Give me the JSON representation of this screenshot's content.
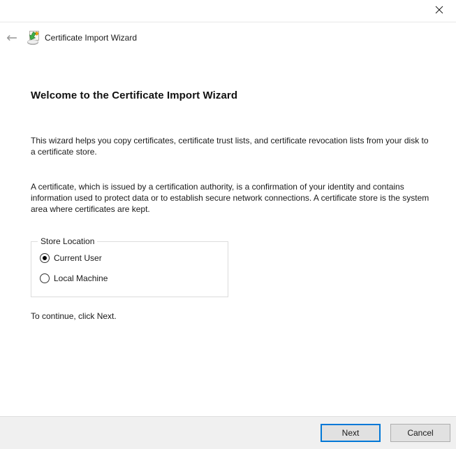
{
  "window": {
    "close_icon": "x-close"
  },
  "header": {
    "back_icon": "arrow-left",
    "back_glyph": "←",
    "icon": "certificate-import-icon",
    "title": "Certificate Import Wizard"
  },
  "main": {
    "heading": "Welcome to the Certificate Import Wizard",
    "paragraph1": "This wizard helps you copy certificates, certificate trust lists, and certificate revocation lists from your disk to a certificate store.",
    "paragraph2": "A certificate, which is issued by a certification authority, is a confirmation of your identity and contains information used to protect data or to establish secure network connections. A certificate store is the system area where certificates are kept.",
    "store_location": {
      "label": "Store Location",
      "options": [
        {
          "label": "Current User",
          "selected": true
        },
        {
          "label": "Local Machine",
          "selected": false
        }
      ]
    },
    "hint": "To continue, click Next."
  },
  "footer": {
    "next_label": "Next",
    "cancel_label": "Cancel"
  },
  "colors": {
    "accent": "#0078d7",
    "footer_bg": "#f0f0f0",
    "button_bg": "#e1e1e1",
    "button_border": "#adadad",
    "divider": "#dfdfdf",
    "heading_text": "#111111"
  }
}
